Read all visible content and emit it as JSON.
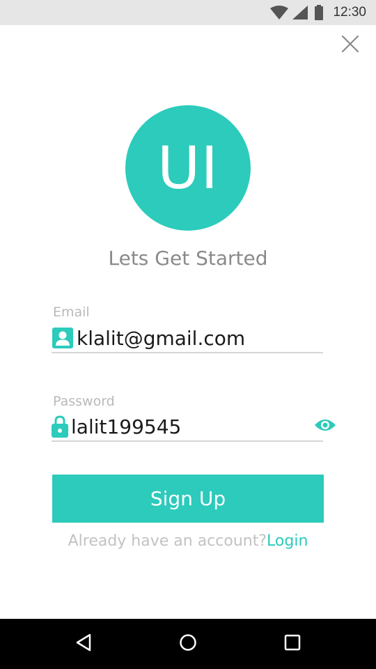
{
  "status_bar": {
    "time": "12:30",
    "icons": [
      "wifi-icon",
      "signal-icon",
      "battery-icon"
    ]
  },
  "header": {
    "close_icon": "close-icon"
  },
  "logo": {
    "text": "UI",
    "color": "#2ccbbb"
  },
  "tagline": "Lets Get Started",
  "form": {
    "email": {
      "label": "Email",
      "value": "klalit@gmail.com",
      "icon": "person-icon"
    },
    "password": {
      "label": "Password",
      "value": "lalit199545",
      "icon": "lock-icon",
      "toggle_icon": "eye-icon"
    },
    "submit_label": "Sign Up"
  },
  "footer": {
    "prompt": "Already have an account?",
    "link": "Login"
  },
  "nav_bar": {
    "icons": [
      "back-icon",
      "home-icon",
      "recents-icon"
    ]
  },
  "colors": {
    "accent": "#2ccbbb",
    "status_bar": "#e6e6e6",
    "nav_bar": "#000000"
  }
}
